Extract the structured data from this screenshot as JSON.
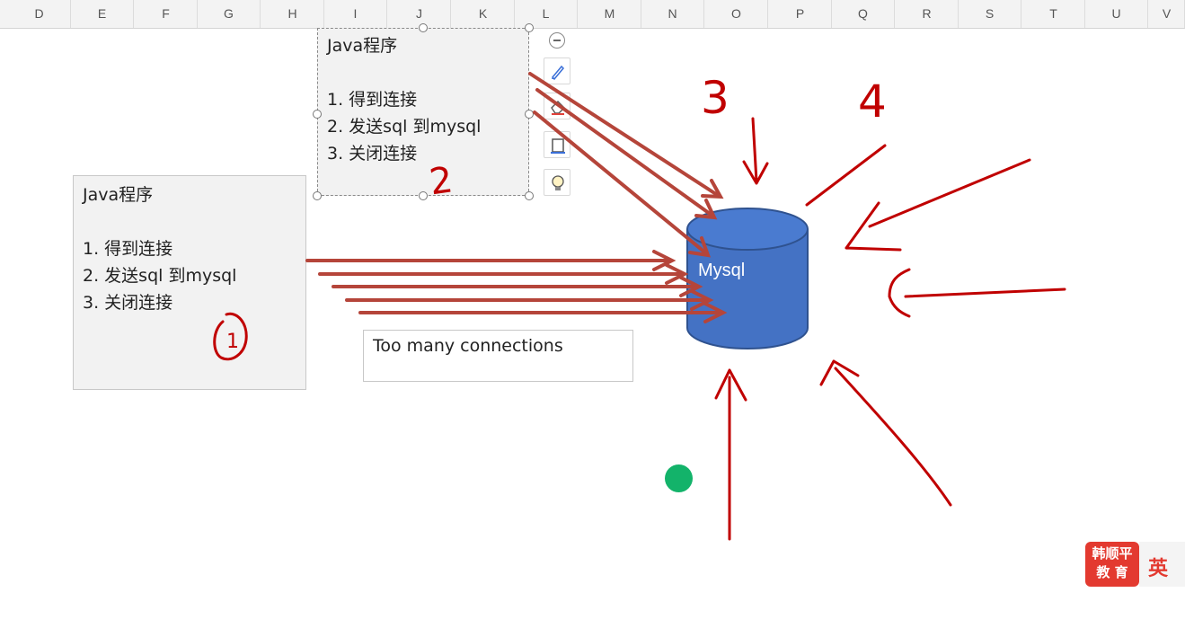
{
  "columns": [
    "D",
    "E",
    "F",
    "G",
    "H",
    "I",
    "J",
    "K",
    "L",
    "M",
    "N",
    "O",
    "P",
    "Q",
    "R",
    "S",
    "T",
    "U",
    "V"
  ],
  "textbox1": {
    "title": "Java程序",
    "step1": "1. 得到连接",
    "step2": "2. 发送sql 到mysql",
    "step3": "3. 关闭连接"
  },
  "textbox2": {
    "title": "Java程序",
    "step1": "1. 得到连接",
    "step2": "2. 发送sql 到mysql",
    "step3": "3. 关闭连接"
  },
  "error_box": {
    "text": "Too many connections"
  },
  "database": {
    "label": "Mysql",
    "fill_color": "#4472c4",
    "stroke_color": "#2f528f"
  },
  "annotations": {
    "n1": "1",
    "n2": "2",
    "n3": "3",
    "n4": "4",
    "color": "#c00000"
  },
  "toolbar_icons": [
    "collapse-icon",
    "pen-icon",
    "eraser-icon",
    "crop-icon",
    "lightbulb-icon"
  ],
  "brand": {
    "line1": "韩顺平",
    "line2": "教 育",
    "color": "#e33a30"
  },
  "ime": {
    "label": "英"
  }
}
